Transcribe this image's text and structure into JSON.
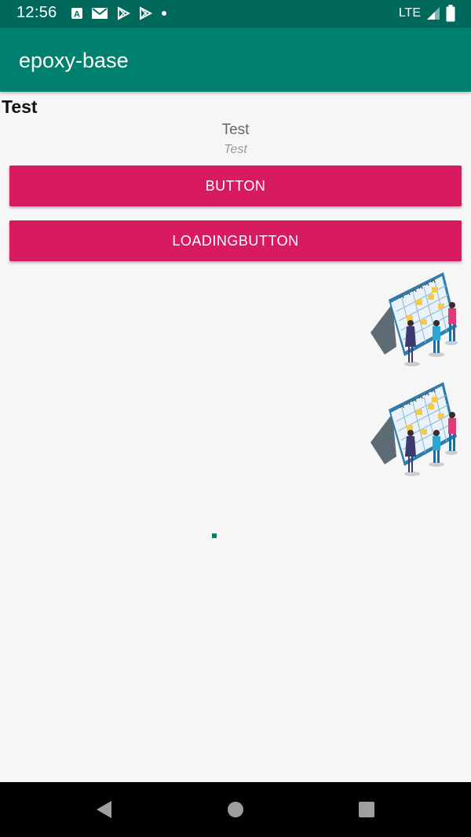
{
  "status_bar": {
    "time": "12:56",
    "network": "LTE",
    "icons": [
      "a-icon",
      "gmail-icon",
      "play-store-icon",
      "play-store-icon",
      "dot-icon"
    ]
  },
  "app_bar": {
    "title": "epoxy-base",
    "background": "#00806f"
  },
  "content": {
    "heading": "Test",
    "title": "Test",
    "subtitle": "Test",
    "buttons": [
      {
        "label": "BUTTON",
        "color": "#d81b60"
      },
      {
        "label": "LOADINGBUTTON",
        "color": "#d81b60"
      }
    ],
    "illustrations": [
      "calendar-planning-illustration",
      "calendar-planning-illustration"
    ]
  },
  "nav_bar": {
    "icons": [
      "back-icon",
      "home-icon",
      "recents-icon"
    ]
  }
}
